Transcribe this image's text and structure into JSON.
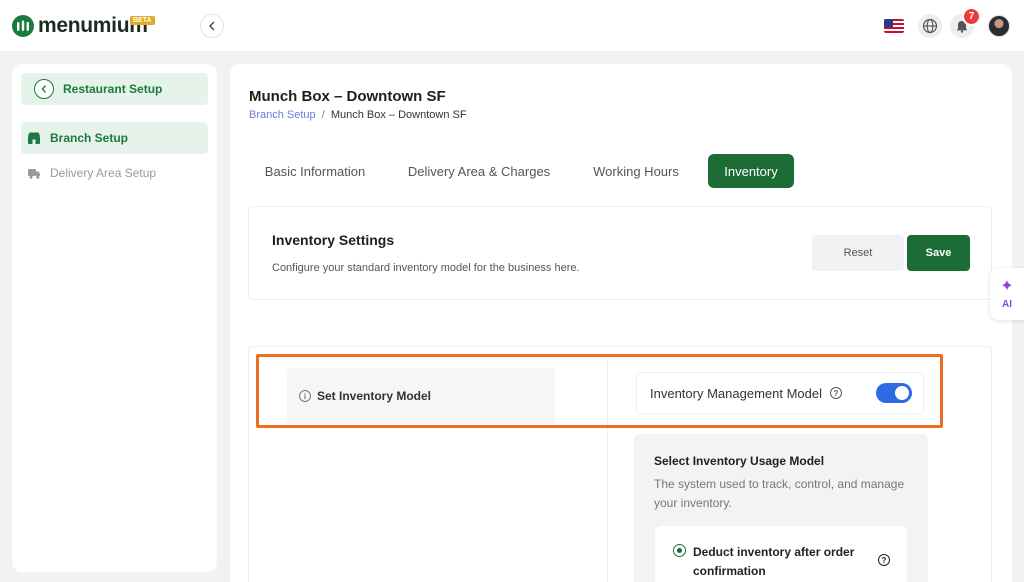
{
  "brand": {
    "name": "menumium",
    "badge": "BETA",
    "accent": "#1b6c35"
  },
  "topbar": {
    "notifications_count": "7",
    "icons": [
      "chevron-left-icon",
      "us-flag-icon",
      "globe-icon",
      "bell-icon",
      "avatar"
    ]
  },
  "sidebar": {
    "header_label": "Restaurant Setup",
    "items": [
      {
        "label": "Branch Setup",
        "icon": "storefront-icon",
        "active": true
      },
      {
        "label": "Delivery Area Setup",
        "icon": "delivery-truck-icon",
        "active": false
      }
    ]
  },
  "page": {
    "title": "Munch Box – Downtown SF",
    "breadcrumb": {
      "parent": "Branch Setup",
      "separator": "/",
      "current": "Munch Box – Downtown SF"
    }
  },
  "tabs": [
    {
      "label": "Basic Information",
      "active": false
    },
    {
      "label": "Delivery Area & Charges",
      "active": false
    },
    {
      "label": "Working Hours",
      "active": false
    },
    {
      "label": "Inventory",
      "active": true
    }
  ],
  "settings": {
    "title": "Inventory Settings",
    "description": "Configure your standard inventory model for the business here.",
    "reset_label": "Reset",
    "save_label": "Save"
  },
  "inventory_model": {
    "section_label": "Set Inventory Model",
    "toggle_label": "Inventory Management Model",
    "toggle_on": true,
    "toggle_color": "#2e6be0",
    "highlight_color": "#ec6f22"
  },
  "usage_model": {
    "title": "Select Inventory Usage Model",
    "description": "The system used to track, control, and manage your inventory.",
    "options": [
      {
        "label": "Deduct inventory after order confirmation",
        "selected": true
      }
    ]
  },
  "ai_widget": {
    "label": "AI",
    "color": "#8e44e0"
  }
}
